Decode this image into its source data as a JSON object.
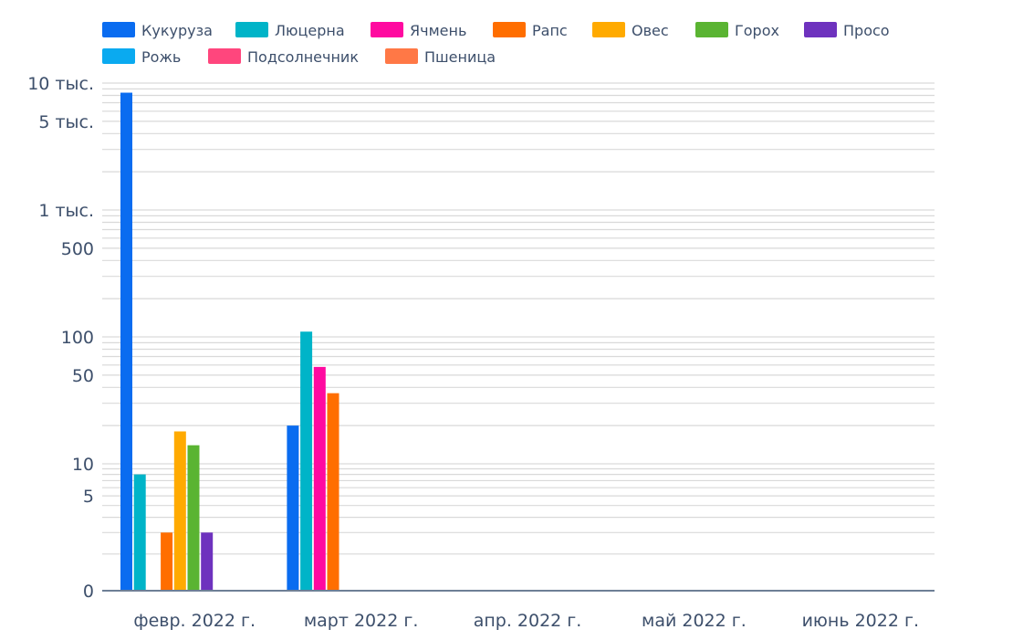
{
  "chart_data": {
    "type": "bar",
    "title": "",
    "xlabel": "",
    "ylabel": "",
    "y_scale": "log",
    "grid": true,
    "legend_position": "top-left",
    "categories": [
      "февр. 2022 г.",
      "март 2022 г.",
      "апр. 2022 г.",
      "май 2022 г.",
      "июнь 2022 г."
    ],
    "y_ticks": [
      {
        "value": 0,
        "label": "0"
      },
      {
        "value": 5,
        "label": "5"
      },
      {
        "value": 10,
        "label": "10"
      },
      {
        "value": 50,
        "label": "50"
      },
      {
        "value": 100,
        "label": "100"
      },
      {
        "value": 500,
        "label": "500"
      },
      {
        "value": 1000,
        "label": "1 тыс."
      },
      {
        "value": 5000,
        "label": "5 тыс."
      },
      {
        "value": 10000,
        "label": "10 тыс."
      }
    ],
    "series": [
      {
        "name": "Кукуруза",
        "color": "#0a6cf0",
        "values": [
          8400,
          20,
          null,
          null,
          null
        ]
      },
      {
        "name": "Люцерна",
        "color": "#00b4c8",
        "values": [
          8,
          110,
          null,
          null,
          null
        ]
      },
      {
        "name": "Ячмень",
        "color": "#ff0aa0",
        "values": [
          null,
          58,
          null,
          null,
          null
        ]
      },
      {
        "name": "Рапс",
        "color": "#ff6e00",
        "values": [
          2,
          36,
          null,
          null,
          null
        ]
      },
      {
        "name": "Овес",
        "color": "#ffaa00",
        "values": [
          18,
          null,
          null,
          null,
          null
        ]
      },
      {
        "name": "Горох",
        "color": "#5ab432",
        "values": [
          14,
          null,
          null,
          null,
          null
        ]
      },
      {
        "name": "Просо",
        "color": "#6e32be",
        "values": [
          2,
          null,
          null,
          null,
          null
        ]
      },
      {
        "name": "Рожь",
        "color": "#0aaaf0",
        "values": [
          null,
          null,
          null,
          null,
          null
        ]
      },
      {
        "name": "Подсолнечник",
        "color": "#ff467d",
        "values": [
          null,
          null,
          null,
          null,
          null
        ]
      },
      {
        "name": "Пшеница",
        "color": "#ff7846",
        "values": [
          null,
          null,
          null,
          null,
          null
        ]
      }
    ]
  }
}
